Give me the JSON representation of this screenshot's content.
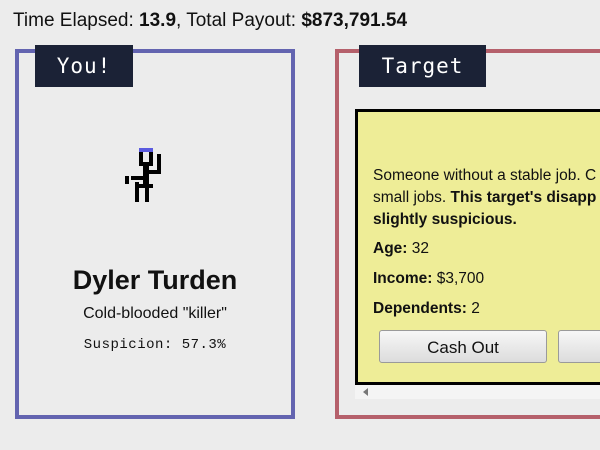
{
  "status": {
    "time_label": "Time Elapsed:",
    "time_value": "13.9",
    "payout_label": "Total Payout:",
    "payout_value": "$873,791.54"
  },
  "you": {
    "tab_label": "You!",
    "name": "Dyler Turden",
    "subtitle": "Cold-blooded \"killer\"",
    "suspicion_text": "Suspicion: 57.3%",
    "suspicion_value": 57.3,
    "sprite_colors": {
      "body": "#000000",
      "hat": "#5b5be0"
    }
  },
  "target": {
    "tab_label": "Target",
    "description_lines": [
      "Someone without a stable job. C",
      "small jobs."
    ],
    "warning_text": "This target's disapp",
    "warning_line2": "slightly suspicious.",
    "age_label": "Age:",
    "age_value": "32",
    "income_label": "Income:",
    "income_value": "$3,700",
    "dependents_label": "Dependents:",
    "dependents_value": "2",
    "cash_out_label": "Cash Out"
  },
  "colors": {
    "you_border": "#6364b0",
    "target_border": "#b5606b",
    "tab_bg": "#1b2236",
    "target_panel_bg": "#eeed97"
  }
}
